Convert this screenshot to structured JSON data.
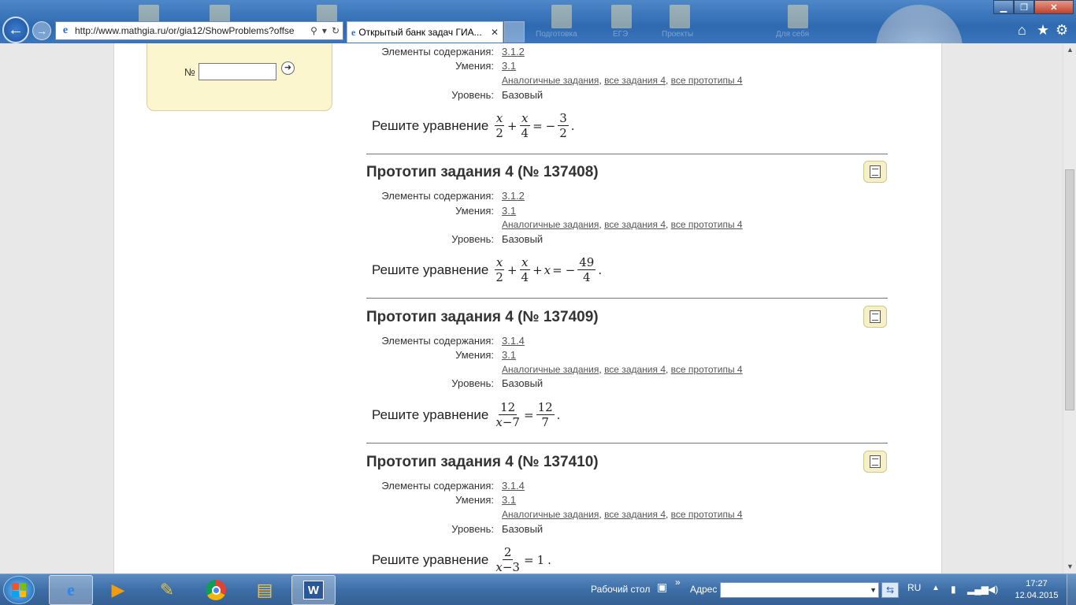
{
  "browser": {
    "url": "http://www.mathgia.ru/or/gia12/ShowProblems?offse",
    "tab_title": "Открытый банк задач ГИА...",
    "tab_close": "✕",
    "back_glyph": "←",
    "forward_glyph": "→",
    "desktop_labels": [
      "Подготовка",
      "ЕГЭ",
      "Проекты",
      "Для себя"
    ]
  },
  "sidebar": {
    "search_label": "№",
    "search_value": "",
    "go_glyph": "➜"
  },
  "problems": [
    {
      "title": "",
      "elements_label": "Элементы содержания:",
      "elements_value": "3.1.2",
      "skills_label": "Умения:",
      "skills_value": "3.1",
      "links": [
        "Аналогичные задания",
        "все задания 4",
        "все прототипы 4"
      ],
      "level_label": "Уровень:",
      "level_value": "Базовый",
      "statement_text": "Решите уравнение",
      "equation": [
        "x/2",
        "+",
        "x/4",
        "=",
        "−",
        "3/2",
        "."
      ]
    },
    {
      "title": "Прототип задания 4 (№ 137408)",
      "elements_label": "Элементы содержания:",
      "elements_value": "3.1.2",
      "skills_label": "Умения:",
      "skills_value": "3.1",
      "links": [
        "Аналогичные задания",
        "все задания 4",
        "все прототипы 4"
      ],
      "level_label": "Уровень:",
      "level_value": "Базовый",
      "statement_text": "Решите уравнение",
      "equation": [
        "x/2",
        "+",
        "x/4",
        "+",
        "x",
        "=",
        "−",
        "49/4",
        "."
      ]
    },
    {
      "title": "Прототип задания 4 (№ 137409)",
      "elements_label": "Элементы содержания:",
      "elements_value": "3.1.4",
      "skills_label": "Умения:",
      "skills_value": "3.1",
      "links": [
        "Аналогичные задания",
        "все задания 4",
        "все прототипы 4"
      ],
      "level_label": "Уровень:",
      "level_value": "Базовый",
      "statement_text": "Решите уравнение",
      "equation": [
        "12/x − 7",
        "=",
        "12/7",
        "."
      ]
    },
    {
      "title": "Прототип задания 4 (№ 137410)",
      "elements_label": "Элементы содержания:",
      "elements_value": "3.1.4",
      "skills_label": "Умения:",
      "skills_value": "3.1",
      "links": [
        "Аналогичные задания",
        "все задания 4",
        "все прототипы 4"
      ],
      "level_label": "Уровень:",
      "level_value": "Базовый",
      "statement_text": "Решите уравнение",
      "equation": [
        "2/x − 3",
        "=",
        "1",
        "."
      ]
    }
  ],
  "taskbar": {
    "desktop_label": "Рабочий стол",
    "chevron": "»",
    "address_label": "Адрес",
    "address_value": "",
    "language": "RU",
    "time": "17:27",
    "date": "12.04.2015",
    "word_letter": "W",
    "ie_letter": "e"
  },
  "colors": {
    "chrome_blue": "#2f69b0",
    "sidebar_yellow": "#fcf6cf",
    "link_gray": "#555555",
    "text_dark": "#333333"
  }
}
